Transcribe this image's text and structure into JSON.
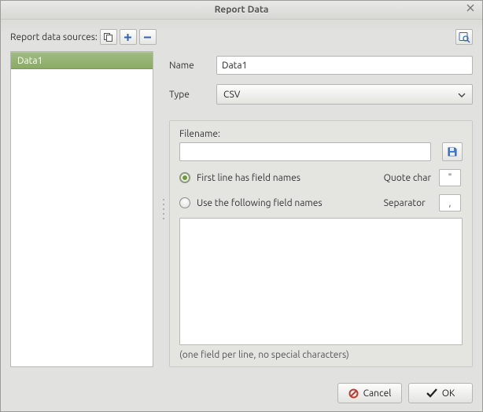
{
  "window": {
    "title": "Report Data"
  },
  "toolbar": {
    "label": "Report data sources:"
  },
  "datasources": {
    "items": [
      {
        "name": "Data1"
      }
    ]
  },
  "form": {
    "name_label": "Name",
    "name_value": "Data1",
    "type_label": "Type",
    "type_value": "CSV"
  },
  "csv": {
    "filename_label": "Filename:",
    "filename_value": "",
    "radio_first_line": "First line has field names",
    "radio_use_following": "Use the following field names",
    "quote_label": "Quote char",
    "quote_value": "\"",
    "separator_label": "Separator",
    "separator_value": ",",
    "fieldnames_value": "",
    "hint": "(one field per line, no special characters)"
  },
  "buttons": {
    "cancel": "Cancel",
    "ok": "OK"
  }
}
